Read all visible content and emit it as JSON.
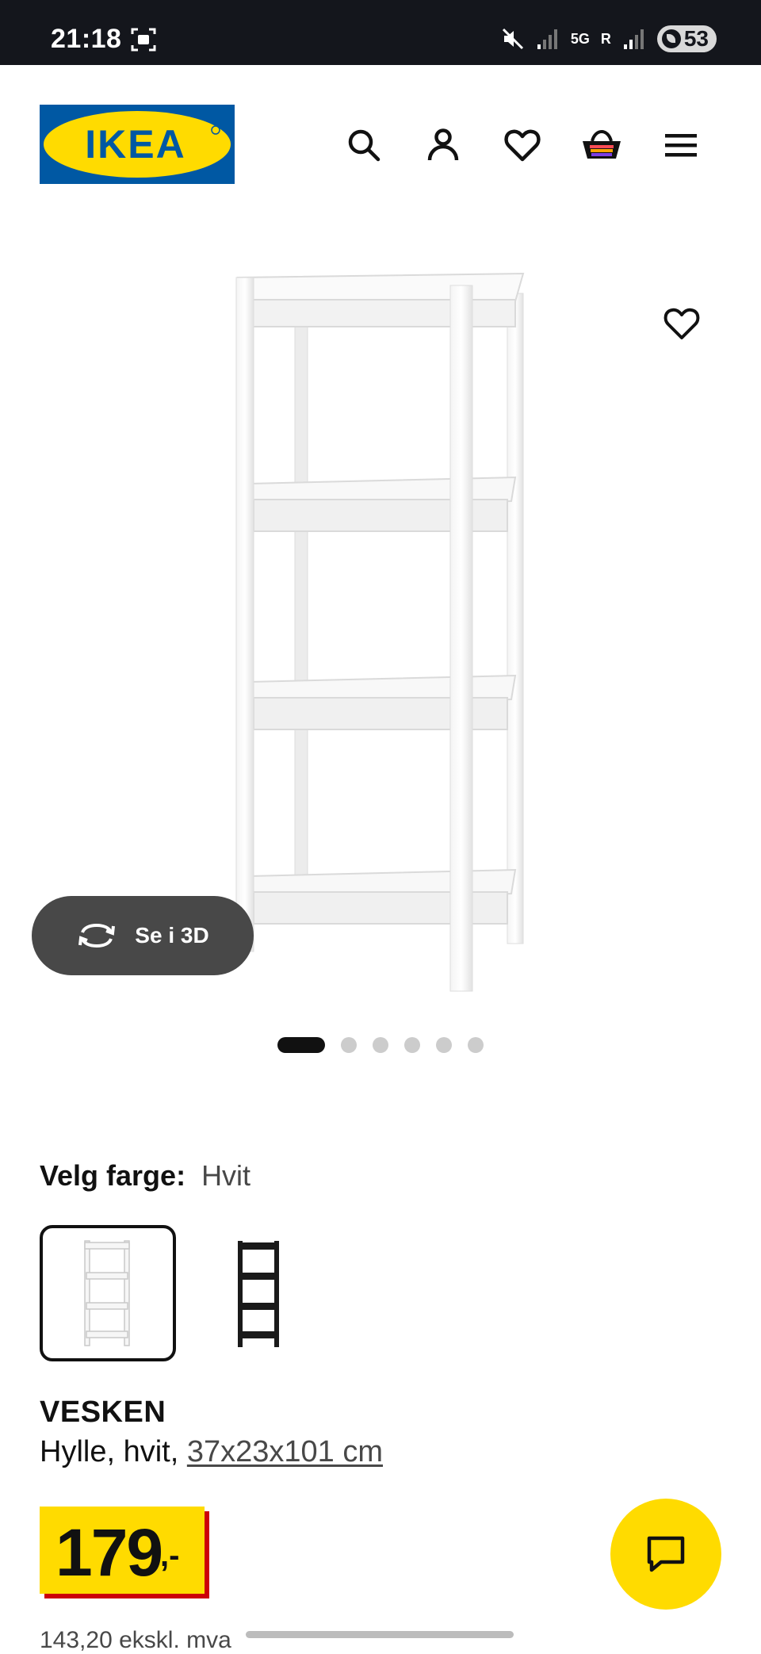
{
  "status_bar": {
    "time": "21:18",
    "battery": "53",
    "network": "5G",
    "roaming": "R"
  },
  "header": {
    "logo_text": "IKEA",
    "icons": [
      "search-icon",
      "account-icon",
      "favourites-icon",
      "cart-icon",
      "menu-icon"
    ]
  },
  "gallery": {
    "view_3d_label": "Se i 3D",
    "image_count": 6,
    "active_index": 0
  },
  "color_selector": {
    "label": "Velg farge:",
    "selected_value": "Hvit",
    "options": [
      "white",
      "black"
    ]
  },
  "product": {
    "name": "VESKEN",
    "description": "Hylle, hvit,",
    "measurements": "37x23x101 cm",
    "price": "179",
    "price_suffix": ",-",
    "price_excl_vat": "143,20 ekskl. mva"
  },
  "colors": {
    "ikea_blue": "#0058a3",
    "ikea_yellow": "#ffdb00",
    "price_shadow": "#cc0008",
    "dark_button": "#484848"
  }
}
